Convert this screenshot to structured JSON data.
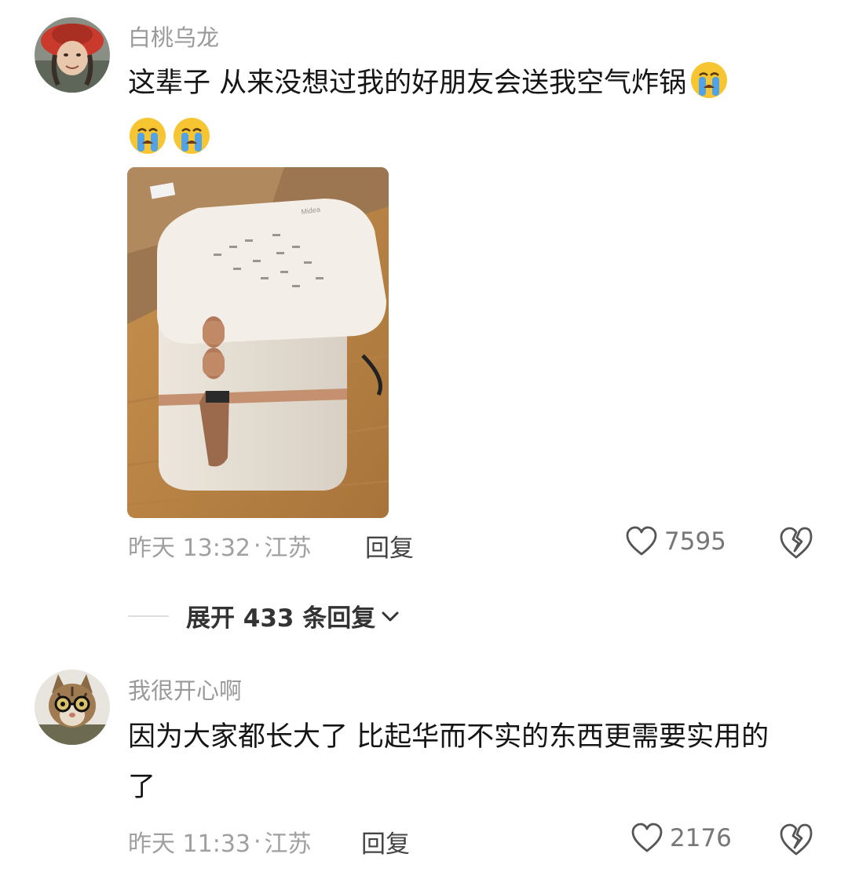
{
  "comments": [
    {
      "username": "白桃乌龙",
      "text": "这辈子 从来没想过我的好朋友会送我空气炸锅",
      "emojis": [
        "loudly-crying-face",
        "loudly-crying-face",
        "loudly-crying-face"
      ],
      "image": {
        "brand": "Midea",
        "description": "air fryer photo"
      },
      "time": "昨天 13:32",
      "separator": "·",
      "location": "江苏",
      "reply_label": "回复",
      "likes": "7595"
    },
    {
      "username": "我很开心啊",
      "text": "因为大家都长大了 比起华而不实的东西更需要实用的了",
      "time": "昨天 11:33",
      "separator": "·",
      "location": "江苏",
      "reply_label": "回复",
      "likes": "2176"
    }
  ],
  "expand_replies": {
    "label": "展开 433 条回复"
  },
  "colors": {
    "username": "#9a9a9a",
    "text": "#151515",
    "meta": "#a0a0a0",
    "icon": "#555555"
  }
}
